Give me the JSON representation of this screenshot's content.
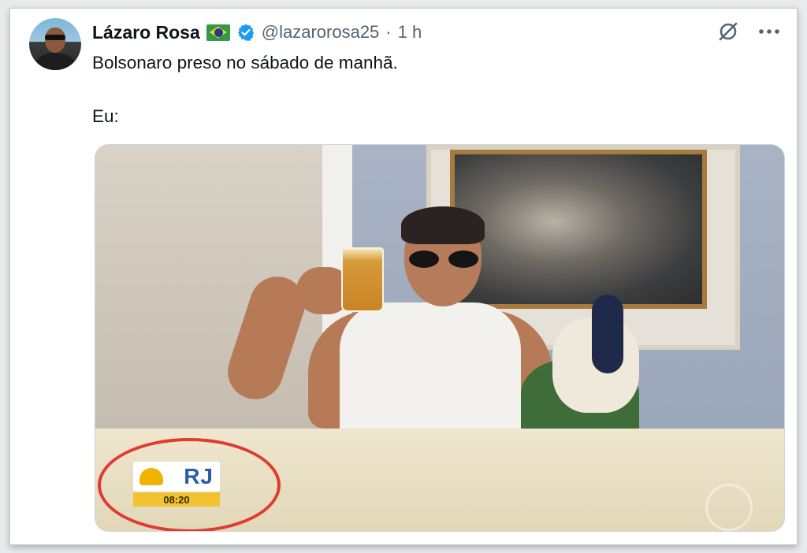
{
  "post": {
    "author_name": "Lázaro Rosa",
    "author_flag": "brazil-flag-icon",
    "handle": "@lazarorosa25",
    "separator": "·",
    "time": "1 h",
    "text": "Bolsonaro preso no sábado de manhã.\n\nEu:",
    "verified_color": "#1d9bf0"
  },
  "media": {
    "overlay_brand": "RJ",
    "overlay_time": "08:20",
    "highlight_color": "#e03b2f"
  }
}
